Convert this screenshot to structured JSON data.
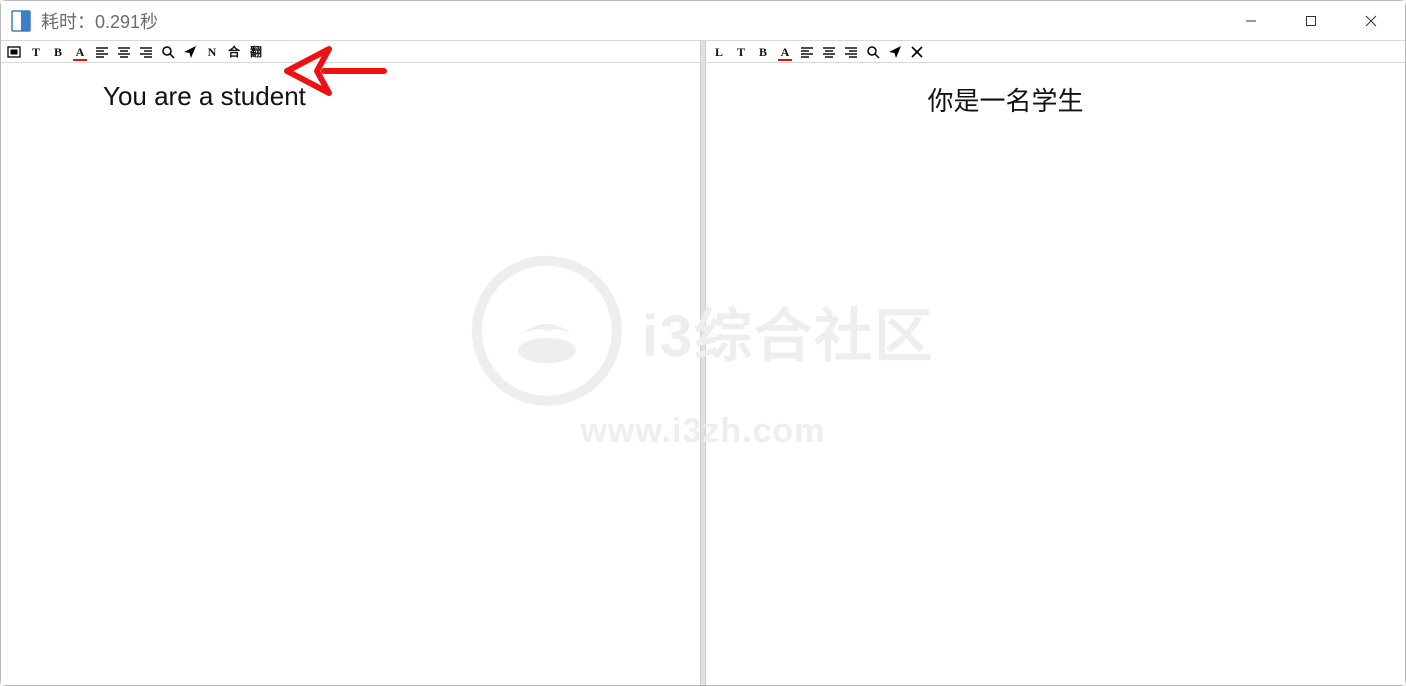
{
  "window": {
    "title": "耗时：0.291秒"
  },
  "left_pane": {
    "content": "You are a student",
    "toolbar": {
      "image_mode": "▢",
      "text_b": "T",
      "bold": "B",
      "font_color": "A",
      "align1": "align-left",
      "align2": "align-center",
      "align3": "align-right",
      "zoom": "search",
      "send": "send",
      "letter_n": "N",
      "merge": "合",
      "translate": "翻"
    }
  },
  "right_pane": {
    "content": "你是一名学生",
    "toolbar": {
      "lang_l": "L",
      "text_t": "T",
      "bold": "B",
      "font_color": "A",
      "align1": "align-left",
      "align2": "align-center",
      "align3": "align-right",
      "zoom": "search",
      "send": "send",
      "close": "close"
    }
  },
  "watermark": {
    "brand": "i3综合社区",
    "url": "www.i3zh.com"
  }
}
